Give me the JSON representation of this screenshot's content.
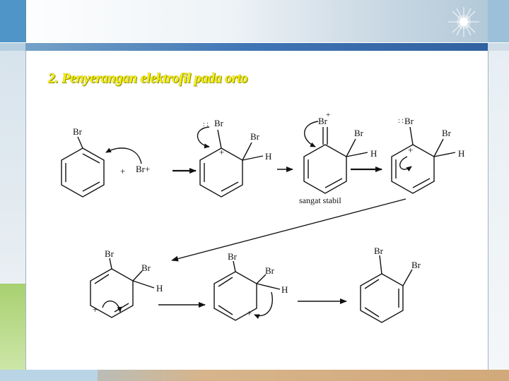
{
  "slide": {
    "title": "2. Penyerangan elektrofil pada orto"
  },
  "labels": {
    "br": "Br",
    "h": "H",
    "plus": "+",
    "br_plus": "Br+",
    "lone_pair": ": :",
    "caption": "sangat stabil"
  },
  "colors": {
    "title": "#f6f000",
    "accent_blue": "#3f74b5",
    "accent_green": "#a8d070"
  }
}
